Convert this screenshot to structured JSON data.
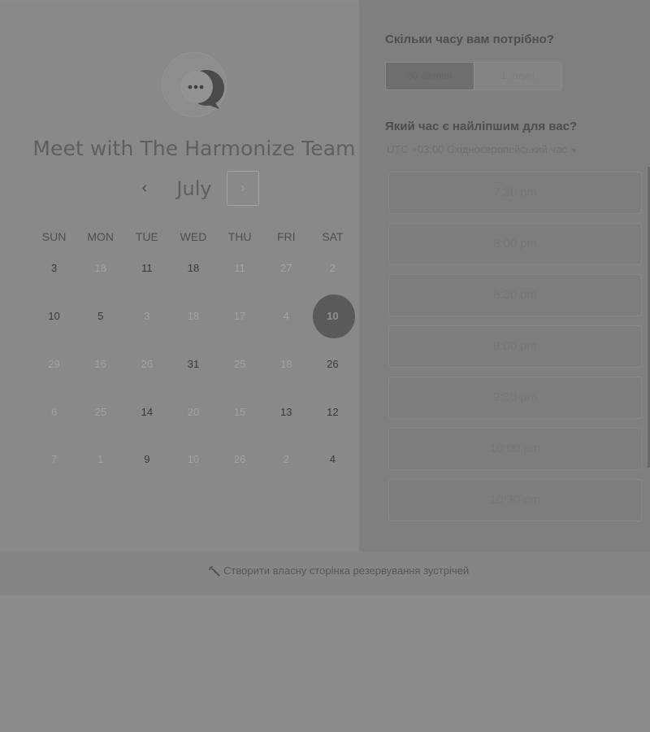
{
  "calendar": {
    "title": "Meet with The Harmonize Team",
    "month": "July",
    "prev_icon": "‹",
    "next_icon": "›",
    "weekdays": [
      "SUN",
      "MON",
      "TUE",
      "WED",
      "THU",
      "FRI",
      "SAT"
    ],
    "rows": [
      [
        {
          "t": "3",
          "s": "on"
        },
        {
          "t": "18",
          "s": "off"
        },
        {
          "t": "11",
          "s": "on"
        },
        {
          "t": "18",
          "s": "on"
        },
        {
          "t": "11",
          "s": "off"
        },
        {
          "t": "27",
          "s": "off"
        },
        {
          "t": "2",
          "s": "off"
        }
      ],
      [
        {
          "t": "10",
          "s": "on"
        },
        {
          "t": "5",
          "s": "on"
        },
        {
          "t": "3",
          "s": "off"
        },
        {
          "t": "18",
          "s": "off"
        },
        {
          "t": "17",
          "s": "off"
        },
        {
          "t": "4",
          "s": "off"
        },
        {
          "t": "10",
          "s": "sel"
        }
      ],
      [
        {
          "t": "29",
          "s": "off"
        },
        {
          "t": "16",
          "s": "off"
        },
        {
          "t": "26",
          "s": "off"
        },
        {
          "t": "31",
          "s": "on"
        },
        {
          "t": "25",
          "s": "off"
        },
        {
          "t": "18",
          "s": "off"
        },
        {
          "t": "26",
          "s": "on"
        }
      ],
      [
        {
          "t": "6",
          "s": "off"
        },
        {
          "t": "25",
          "s": "off"
        },
        {
          "t": "14",
          "s": "on"
        },
        {
          "t": "20",
          "s": "off"
        },
        {
          "t": "15",
          "s": "off"
        },
        {
          "t": "13",
          "s": "on"
        },
        {
          "t": "12",
          "s": "on"
        }
      ],
      [
        {
          "t": "7",
          "s": "off"
        },
        {
          "t": "1",
          "s": "off"
        },
        {
          "t": "9",
          "s": "on"
        },
        {
          "t": "10",
          "s": "off"
        },
        {
          "t": "26",
          "s": "off"
        },
        {
          "t": "2",
          "s": "off"
        },
        {
          "t": "4",
          "s": "on"
        }
      ]
    ]
  },
  "booking": {
    "duration_question": "Скільки часу вам потрібно?",
    "durations": [
      {
        "label": "30 хвилин",
        "active": true
      },
      {
        "label": "1 годин",
        "active": false
      }
    ],
    "time_question": "Який час є найліпшим для вас?",
    "timezone": "UTC +03:00 Східноєвропейський час",
    "timezone_caret": "▼",
    "slots": [
      "7:30 pm",
      "8:00 pm",
      "8:30 pm",
      "9:00 pm",
      "9:30 pm",
      "10:00 pm",
      "10:30 pm"
    ]
  },
  "footer": {
    "link": "Створити власну сторінка резервування зустрічей"
  },
  "icons": {
    "avatar": "chat-bubble-icon",
    "footer": "magic-wand-icon"
  }
}
